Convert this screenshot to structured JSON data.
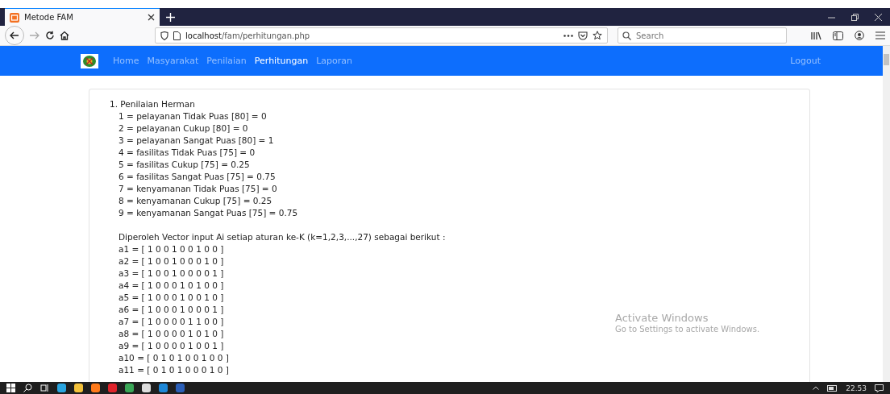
{
  "browser": {
    "tabs": [
      {
        "title": "Metode FAM",
        "selected": true
      }
    ],
    "url_host": "localhost",
    "url_path": "/fam/perhitungan.php",
    "search_placeholder": "Search"
  },
  "navbar": {
    "items": [
      {
        "label": "Home",
        "selected": false
      },
      {
        "label": "Masyarakat",
        "selected": false
      },
      {
        "label": "Penilaian",
        "selected": false
      },
      {
        "label": "Perhitungan",
        "selected": true
      },
      {
        "label": "Laporan",
        "selected": false
      }
    ],
    "logout": "Logout"
  },
  "content": {
    "heading": "1. Penilaian Herman",
    "memberships": [
      "1 = pelayanan Tidak Puas [80] = 0",
      "2 = pelayanan Cukup [80] = 0",
      "3 = pelayanan Sangat Puas [80] = 1",
      "4 = fasilitas Tidak Puas [75] = 0",
      "5 = fasilitas Cukup [75] = 0.25",
      "6 = fasilitas Sangat Puas [75] = 0.75",
      "7 = kenyamanan Tidak Puas [75] = 0",
      "8 = kenyamanan Cukup [75] = 0.25",
      "9 = kenyamanan Sangat Puas [75] = 0.75"
    ],
    "vector_intro": "Diperoleh Vector input Ai setiap aturan ke-K (k=1,2,3,...,27) sebagai berikut :",
    "vectors": [
      "a1 = [ 1 0 0 1 0 0 1 0 0 ]",
      "a2 = [ 1 0 0 1 0 0 0 1 0 ]",
      "a3 = [ 1 0 0 1 0 0 0 0 1 ]",
      "a4 = [ 1 0 0 0 1 0 1 0 0 ]",
      "a5 = [ 1 0 0 0 1 0 0 1 0 ]",
      "a6 = [ 1 0 0 0 1 0 0 0 1 ]",
      "a7 = [ 1 0 0 0 0 1 1 0 0 ]",
      "a8 = [ 1 0 0 0 0 1 0 1 0 ]",
      "a9 = [ 1 0 0 0 0 1 0 0 1 ]",
      "a10 = [ 0 1 0 1 0 0 1 0 0 ]",
      "a11 = [ 0 1 0 1 0 0 0 1 0 ]"
    ]
  },
  "activation": {
    "title": "Activate Windows",
    "subtitle": "Go to Settings to activate Windows."
  },
  "taskbar": {
    "clock": "22.53"
  }
}
